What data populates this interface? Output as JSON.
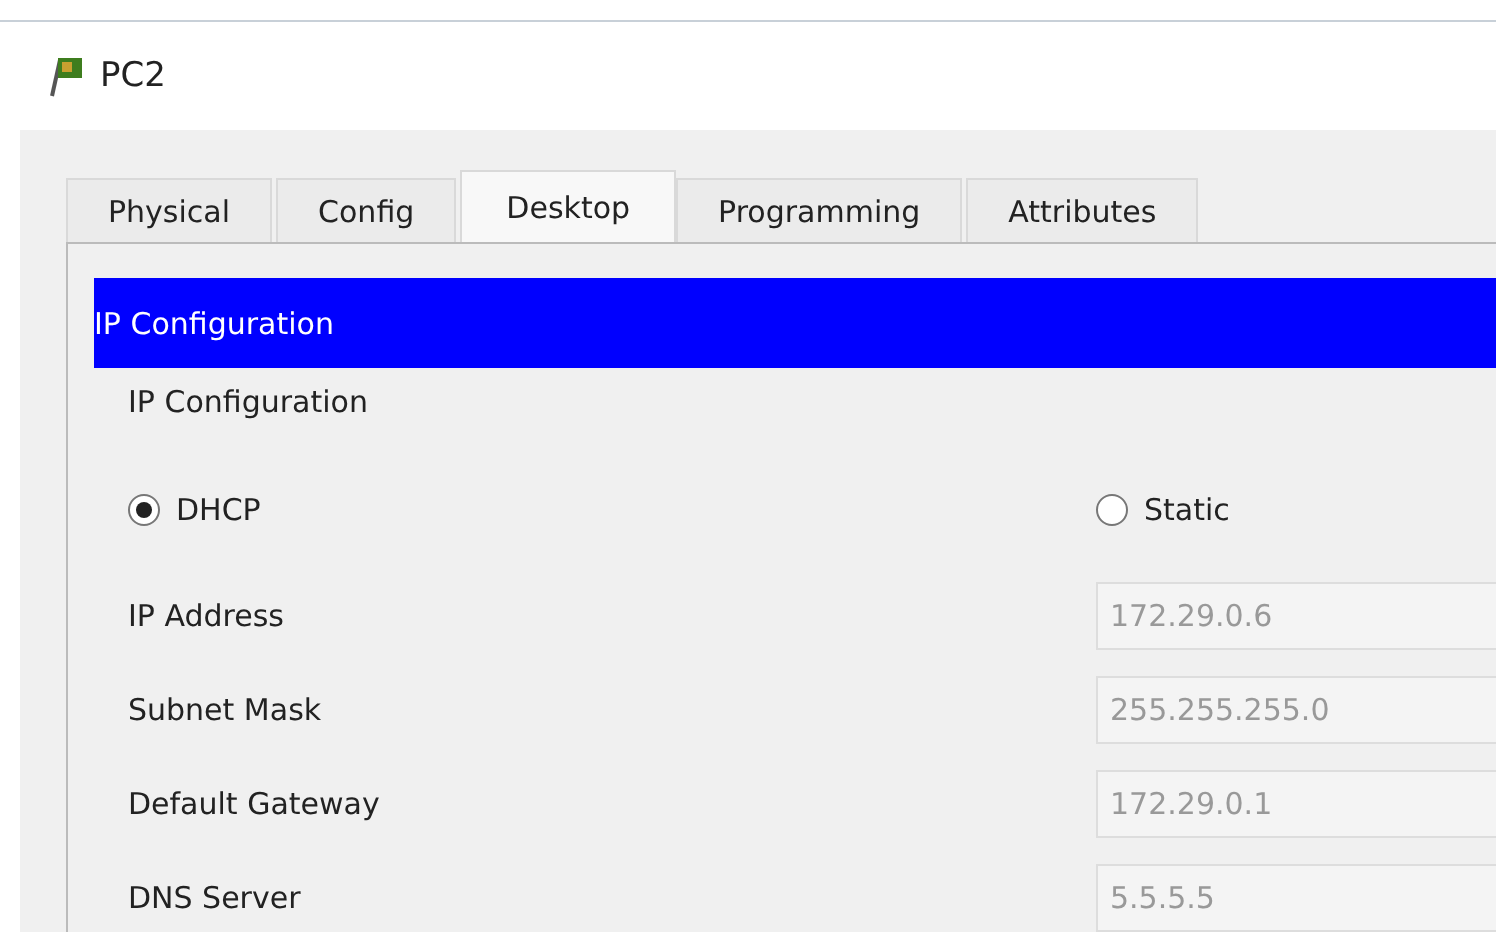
{
  "window": {
    "title": "PC2"
  },
  "tabs": [
    {
      "label": "Physical",
      "selected": false
    },
    {
      "label": "Config",
      "selected": false
    },
    {
      "label": "Desktop",
      "selected": true
    },
    {
      "label": "Programming",
      "selected": false
    },
    {
      "label": "Attributes",
      "selected": false
    }
  ],
  "panel": {
    "header": "IP Configuration",
    "group_title": "IP Configuration",
    "modes": [
      {
        "label": "DHCP",
        "selected": true
      },
      {
        "label": "Static",
        "selected": false
      }
    ],
    "fields": [
      {
        "label": "IP Address",
        "value": "172.29.0.6",
        "disabled": true
      },
      {
        "label": "Subnet Mask",
        "value": "255.255.255.0",
        "disabled": true
      },
      {
        "label": "Default Gateway",
        "value": "172.29.0.1",
        "disabled": true
      },
      {
        "label": "DNS Server",
        "value": "5.5.5.5",
        "disabled": true
      }
    ]
  }
}
